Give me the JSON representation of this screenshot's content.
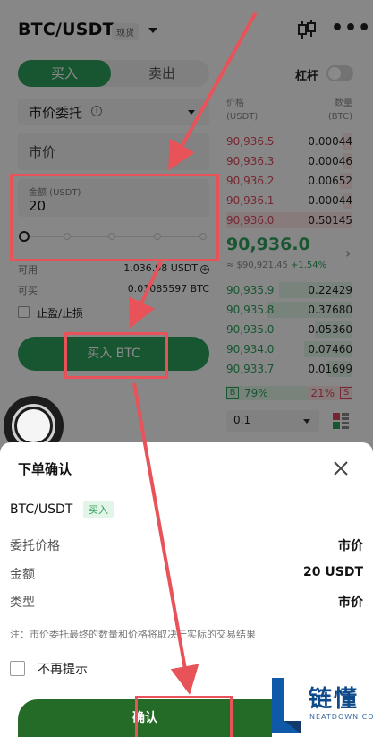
{
  "header": {
    "pair": "BTC/USDT",
    "market_tag": "现货",
    "kline_icon": "candlestick-icon",
    "more_icon": "more-dots-icon"
  },
  "trade_panel": {
    "tabs": {
      "buy": "买入",
      "sell": "卖出",
      "active": "buy"
    },
    "leverage_label": "杠杆",
    "leverage_on": false,
    "order_type": "市价委托",
    "price_field": "市价",
    "amount_label": "金额 (USDT)",
    "amount_value": "20",
    "slider_percent": 0,
    "available_label": "可用",
    "available_value": "1,036.98 USDT",
    "buyable_label": "可买",
    "buyable_value": "0.01085597 BTC",
    "tpsl_label": "止盈/止损",
    "buy_button": "买入 BTC"
  },
  "orderbook": {
    "price_header": [
      "价格",
      "(USDT)"
    ],
    "qty_header": [
      "数量",
      "(BTC)"
    ],
    "asks": [
      {
        "price": "90,936.5",
        "qty": "0.00044",
        "depth": 0.08
      },
      {
        "price": "90,936.3",
        "qty": "0.00046",
        "depth": 0.08
      },
      {
        "price": "90,936.2",
        "qty": "0.00652",
        "depth": 0.1
      },
      {
        "price": "90,936.1",
        "qty": "0.00044",
        "depth": 0.08
      },
      {
        "price": "90,936.0",
        "qty": "0.50145",
        "depth": 1.0
      }
    ],
    "last_price": "90,936.0",
    "last_usd": "≈ $90,921.45",
    "last_change": "+1.54%",
    "bids": [
      {
        "price": "90,935.9",
        "qty": "0.22429",
        "depth": 0.58
      },
      {
        "price": "90,935.8",
        "qty": "0.37680",
        "depth": 0.68
      },
      {
        "price": "90,935.0",
        "qty": "0.05360",
        "depth": 0.3
      },
      {
        "price": "90,934.0",
        "qty": "0.07460",
        "depth": 0.38
      },
      {
        "price": "90,933.7",
        "qty": "0.01699",
        "depth": 0.2
      }
    ],
    "buy_tag": "B",
    "buy_ratio": "79%",
    "sell_tag": "S",
    "sell_ratio": "21%",
    "depth_step": "0.1"
  },
  "confirm_sheet": {
    "title": "下单确认",
    "pair": "BTC/USDT",
    "side_tag": "买入",
    "rows": [
      {
        "key": "委托价格",
        "value": "市价"
      },
      {
        "key": "金额",
        "value": "20 USDT"
      },
      {
        "key": "类型",
        "value": "市价"
      }
    ],
    "note": "注：市价委托最终的数量和价格将取决于实际的交易结果",
    "no_remind": "不再提示",
    "confirm_button": "确认"
  },
  "watermark": {
    "name": "链懂",
    "domain": "NEATDOWN.COM"
  },
  "colors": {
    "buy_green": "#2ba05a",
    "sell_red": "#d9495b",
    "annotation_red": "#e8535a",
    "brand_blue": "#0e4a8a"
  }
}
